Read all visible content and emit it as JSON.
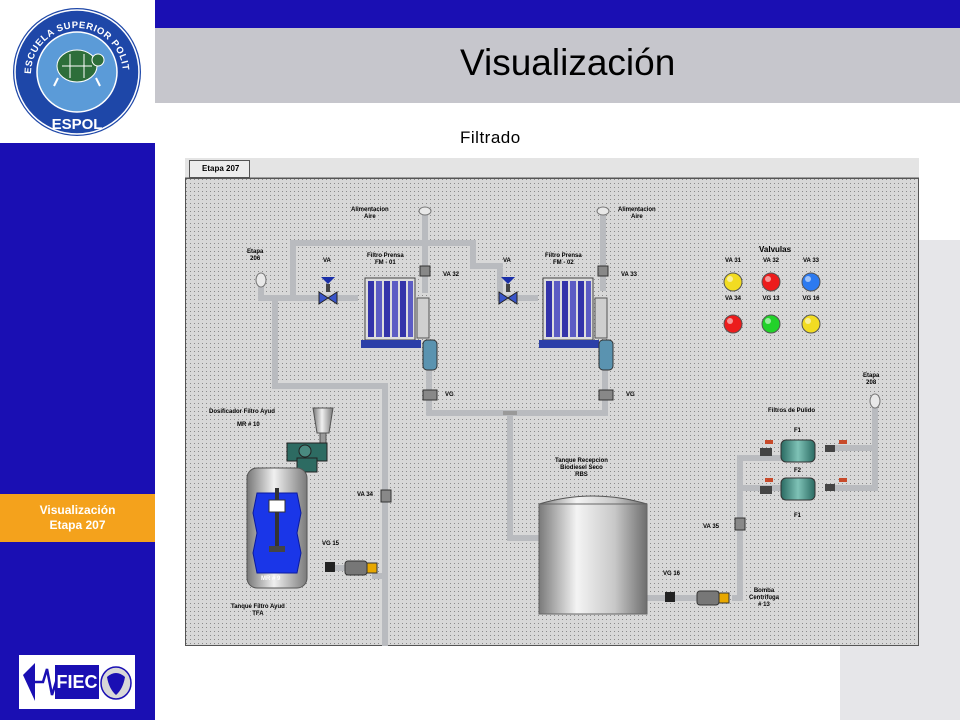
{
  "header": {
    "title": "Visualización",
    "subtitle": "Filtrado"
  },
  "nav": {
    "line1": "Visualización",
    "line2": "Etapa 207"
  },
  "logos": {
    "espol_ring": "ESCUELA SUPERIOR POLITECNICA DEL LITORAL",
    "espol_name": "ESPOL",
    "fiec_name": "FIEC"
  },
  "hmi": {
    "tab": "Etapa 207",
    "alim_left": "Alimentacion\nAire",
    "alim_right": "Alimentacion\nAire",
    "etapa_in": "Etapa\n206",
    "etapa_out": "Etapa\n208",
    "fp1": "Filtro Prensa\nFM - 01",
    "fp2": "Filtro Prensa\nFM - 02",
    "va_left": "VA",
    "va_right": "VA",
    "va32": "VA 32",
    "va33": "VA 33",
    "vg_left": "VG",
    "vg_right": "VG",
    "valvulas_title": "Valvulas",
    "dosif": "Dosificador Filtro Ayud",
    "mr10": "MR # 10",
    "mr9": "MR # 9",
    "va34": "VA 34",
    "vg15": "VG 15",
    "tanque_filtro": "Tanque Filtro Ayud\nTFA",
    "tanque_rec": "Tanque Recepcion\nBiodiesel Seco\nRBS",
    "vg16": "VG 16",
    "bomba": "Bomba\nCentrifuga\n# 13",
    "va35": "VA 35",
    "filtros_pulido": "Filtros de Pulido",
    "f1_top": "F1",
    "f2": "F2",
    "f1_bottom": "F1",
    "valves": [
      {
        "label": "VA 31",
        "color": "#f2dc22"
      },
      {
        "label": "VA 32",
        "color": "#ec1c1c"
      },
      {
        "label": "VA 33",
        "color": "#2c7af0"
      },
      {
        "label": "VA 34",
        "color": "#ec1c1c"
      },
      {
        "label": "VG 13",
        "color": "#22d22a"
      },
      {
        "label": "VG 16",
        "color": "#f2dc22"
      }
    ]
  }
}
